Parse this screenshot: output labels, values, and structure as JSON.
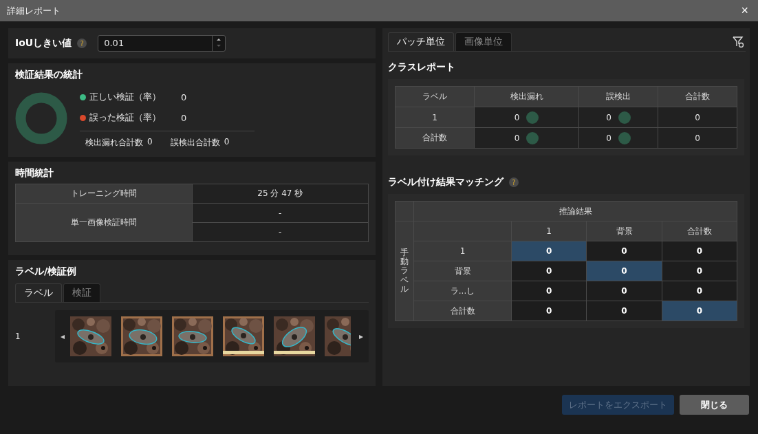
{
  "window": {
    "title": "詳細レポート",
    "close": "×"
  },
  "iou": {
    "label": "IoUしきい値",
    "help": "?",
    "value": "0.01"
  },
  "stats": {
    "title": "検証結果の統計",
    "legend": [
      {
        "label": "正しい検証（率）",
        "value": "0",
        "color": "#3dbb85"
      },
      {
        "label": "誤った検証（率）",
        "value": "0",
        "color": "#d9482b"
      }
    ],
    "totals": [
      {
        "label": "検出漏れ合計数",
        "value": "0"
      },
      {
        "label": "誤検出合計数",
        "value": "0"
      }
    ]
  },
  "time": {
    "title": "時間統計",
    "rows": [
      {
        "label": "トレーニング時間",
        "values": [
          "25 分 47 秒"
        ]
      },
      {
        "label": "単一画像検証時間",
        "values": [
          "-",
          "-"
        ]
      }
    ]
  },
  "examples": {
    "title": "ラベル/検証例",
    "tabs": [
      {
        "label": "ラベル",
        "selected": true
      },
      {
        "label": "検証",
        "selected": false
      }
    ],
    "row_label": "1",
    "prev": "◂",
    "next": "▸"
  },
  "tabs": [
    {
      "label": "パッチ単位",
      "selected": true
    },
    {
      "label": "画像単位",
      "selected": false
    }
  ],
  "class_report": {
    "title": "クラスレポート",
    "columns": [
      "ラベル",
      "検出漏れ",
      "誤検出",
      "合計数"
    ],
    "rows": [
      {
        "cells": [
          {
            "value": "1"
          },
          {
            "value": "0",
            "color": "#2d5a47"
          },
          {
            "value": "0",
            "color": "#2d5a47"
          },
          {
            "value": "0"
          }
        ]
      },
      {
        "cells": [
          {
            "value": "合計数"
          },
          {
            "value": "0",
            "color": "#2d5a47"
          },
          {
            "value": "0",
            "color": "#2d5a47"
          },
          {
            "value": "0"
          }
        ]
      }
    ]
  },
  "matching": {
    "title": "ラベル付け結果マッチング",
    "help": "?",
    "col_group": "推論結果",
    "row_group": "手動ラベル",
    "columns": [
      "1",
      "背景",
      "合計数"
    ],
    "rows": [
      {
        "label": "1",
        "cells": [
          {
            "value": "0",
            "highlighted": true
          },
          {
            "value": "0",
            "highlighted": false
          },
          {
            "value": "0",
            "highlighted": false
          }
        ]
      },
      {
        "label": "背景",
        "cells": [
          {
            "value": "0",
            "highlighted": false
          },
          {
            "value": "0",
            "highlighted": true
          },
          {
            "value": "0",
            "highlighted": false
          }
        ]
      },
      {
        "label": "ラ...し",
        "cells": [
          {
            "value": "0",
            "highlighted": false
          },
          {
            "value": "0",
            "highlighted": false
          },
          {
            "value": "0",
            "highlighted": false
          }
        ]
      },
      {
        "label": "合計数",
        "cells": [
          {
            "value": "0",
            "highlighted": false
          },
          {
            "value": "0",
            "highlighted": false
          },
          {
            "value": "0",
            "highlighted": true
          }
        ]
      }
    ]
  },
  "buttons": [
    {
      "label": "レポートをエクスポート",
      "disabled": true
    },
    {
      "label": "閉じる",
      "disabled": false
    }
  ]
}
